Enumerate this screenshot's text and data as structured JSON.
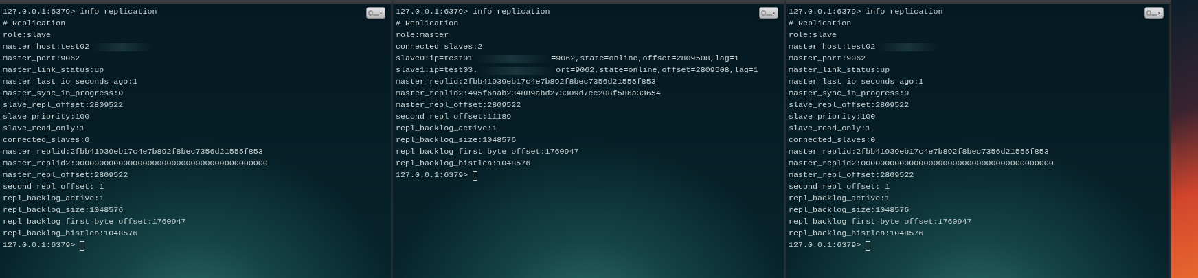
{
  "panes": [
    {
      "command_line": {
        "prompt": "127.0.0.1:6379>",
        "command": "info replication"
      },
      "lines": [
        {
          "text": "# Replication"
        },
        {
          "text": "role:slave"
        },
        {
          "text": "master_host:test02",
          "redacted": true
        },
        {
          "text": "master_port:9062"
        },
        {
          "text": "master_link_status:up"
        },
        {
          "text": "master_last_io_seconds_ago:1"
        },
        {
          "text": "master_sync_in_progress:0"
        },
        {
          "text": "slave_repl_offset:2809522"
        },
        {
          "text": "slave_priority:100"
        },
        {
          "text": "slave_read_only:1"
        },
        {
          "text": "connected_slaves:0"
        },
        {
          "text": "master_replid:2fbb41939eb17c4e7b892f8bec7356d21555f853"
        },
        {
          "text": "master_replid2:0000000000000000000000000000000000000000"
        },
        {
          "text": "master_repl_offset:2809522"
        },
        {
          "text": "second_repl_offset:-1"
        },
        {
          "text": "repl_backlog_active:1"
        },
        {
          "text": "repl_backlog_size:1048576"
        },
        {
          "text": "repl_backlog_first_byte_offset:1760947"
        },
        {
          "text": "repl_backlog_histlen:1048576"
        }
      ],
      "prompt": "127.0.0.1:6379>",
      "cursor": true
    },
    {
      "command_line": {
        "prompt": "127.0.0.1:6379>",
        "command": "info replication"
      },
      "lines": [
        {
          "text": "# Replication"
        },
        {
          "text": "role:master"
        },
        {
          "text": "connected_slaves:2"
        },
        {
          "text": "slave0:ip=test01",
          "redacted": true,
          "rest": "=9062,state=online,offset=2809508,lag=1"
        },
        {
          "text": "slave1:ip=test03.",
          "redacted": true,
          "rest": "ort=9062,state=online,offset=2809508,lag=1"
        },
        {
          "text": "master_replid:2fbb41939eb17c4e7b892f8bec7356d21555f853"
        },
        {
          "text": "master_replid2:495f6aab234889abd273309d7ec208f586a33654"
        },
        {
          "text": "master_repl_offset:2809522"
        },
        {
          "text": "second_repl_offset:11189"
        },
        {
          "text": "repl_backlog_active:1"
        },
        {
          "text": "repl_backlog_size:1048576"
        },
        {
          "text": "repl_backlog_first_byte_offset:1760947"
        },
        {
          "text": "repl_backlog_histlen:1048576"
        }
      ],
      "prompt": "127.0.0.1:6379>",
      "cursor": true
    },
    {
      "command_line": {
        "prompt": "127.0.0.1:6379>",
        "command": "info replication"
      },
      "lines": [
        {
          "text": "# Replication"
        },
        {
          "text": "role:slave"
        },
        {
          "text": "master_host:test02",
          "redacted": true
        },
        {
          "text": "master_port:9062"
        },
        {
          "text": "master_link_status:up"
        },
        {
          "text": "master_last_io_seconds_ago:1"
        },
        {
          "text": "master_sync_in_progress:0"
        },
        {
          "text": "slave_repl_offset:2809522"
        },
        {
          "text": "slave_priority:100"
        },
        {
          "text": "slave_read_only:1"
        },
        {
          "text": "connected_slaves:0"
        },
        {
          "text": "master_replid:2fbb41939eb17c4e7b892f8bec7356d21555f853"
        },
        {
          "text": "master_replid2:0000000000000000000000000000000000000000"
        },
        {
          "text": "master_repl_offset:2809522"
        },
        {
          "text": "second_repl_offset:-1"
        },
        {
          "text": "repl_backlog_active:1"
        },
        {
          "text": "repl_backlog_size:1048576"
        },
        {
          "text": "repl_backlog_first_byte_offset:1760947"
        },
        {
          "text": "repl_backlog_histlen:1048576"
        }
      ],
      "prompt": "127.0.0.1:6379>",
      "cursor": true
    }
  ]
}
